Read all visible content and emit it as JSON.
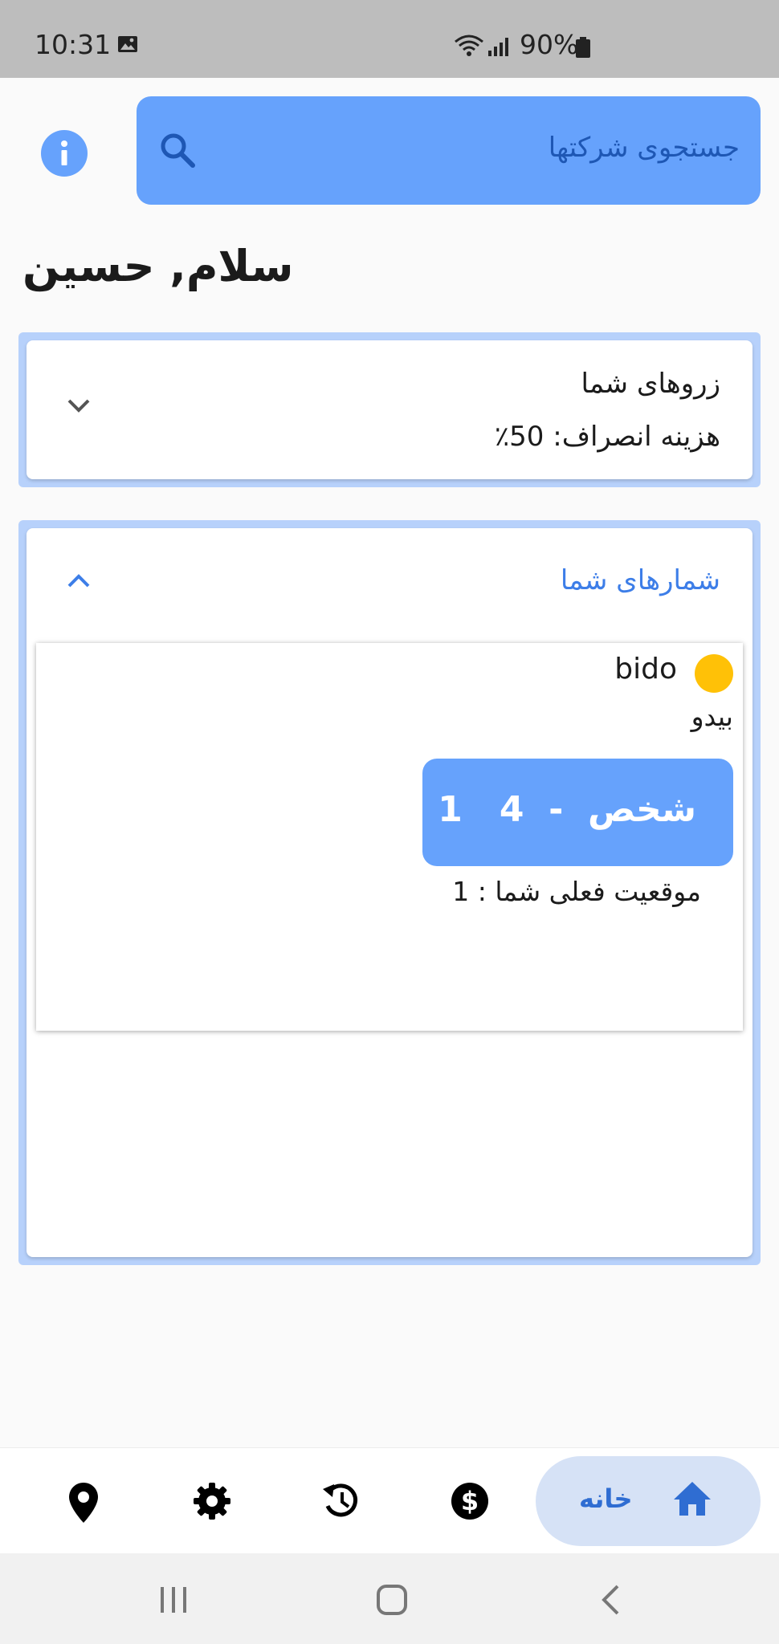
{
  "status_bar": {
    "time": "10:31",
    "battery": "90%"
  },
  "search": {
    "placeholder": "جستجوی شرکتها"
  },
  "greeting": "سلام, حسین",
  "reservations_card": {
    "title": "زروهای شما",
    "cancel_fee": "هزینه انصراف: 50٪"
  },
  "numbers_card": {
    "title": "شمارهای شما",
    "ticket": {
      "company_name": "bido",
      "company_name_fa": "بیدو",
      "queue_label": "شخص  -  4   1",
      "position_text": "موقعیت فعلی شما : 1",
      "status_color": "#ffc107"
    }
  },
  "bottom_nav": {
    "home_label": "خانه",
    "items": [
      "home-icon",
      "dollar-icon",
      "history-icon",
      "settings-icon",
      "location-icon"
    ]
  },
  "colors": {
    "accent": "#66a2fc",
    "accent_text": "#1e57b4",
    "card_border": "#b7d1fb"
  }
}
